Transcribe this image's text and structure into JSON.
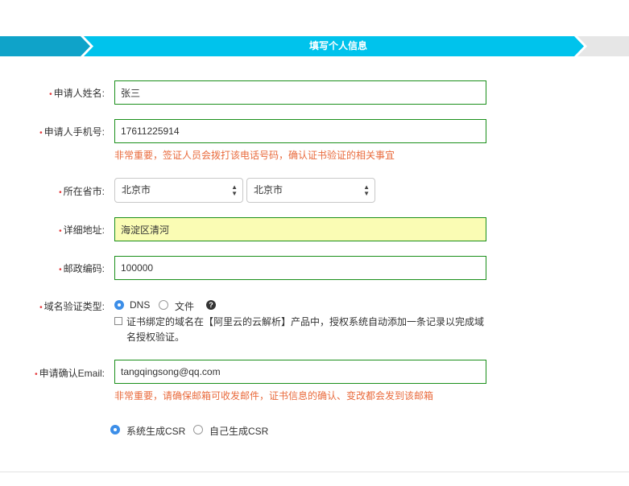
{
  "steps": {
    "current_label": "填写个人信息"
  },
  "form": {
    "name": {
      "label": "申请人姓名:",
      "value": "张三"
    },
    "phone": {
      "label": "申请人手机号:",
      "value": "17611225914",
      "hint": "非常重要，签证人员会拨打该电话号码，确认证书验证的相关事宜"
    },
    "region": {
      "label": "所在省市:",
      "province": "北京市",
      "city": "北京市"
    },
    "address": {
      "label": "详细地址:",
      "value": "海淀区清河"
    },
    "postcode": {
      "label": "邮政编码:",
      "value": "100000"
    },
    "domain_verify": {
      "label": "域名验证类型:",
      "options": [
        "DNS",
        "文件"
      ],
      "selected": "DNS",
      "help_icon": "?",
      "checkbox_text": "证书绑定的域名在【阿里云的云解析】产品中，授权系统自动添加一条记录以完成域名授权验证。"
    },
    "email": {
      "label": "申请确认Email:",
      "value": "tangqingsong@qq.com",
      "hint": "非常重要，请确保邮箱可收发邮件，证书信息的确认、变改都会发到该邮箱"
    },
    "csr": {
      "options": [
        "系统生成CSR",
        "自己生成CSR"
      ],
      "selected": "系统生成CSR"
    }
  },
  "colors": {
    "accent": "#00c3ec",
    "dark_step": "#0fa3c9",
    "hint": "#e96b3d",
    "required": "#e4393c"
  }
}
